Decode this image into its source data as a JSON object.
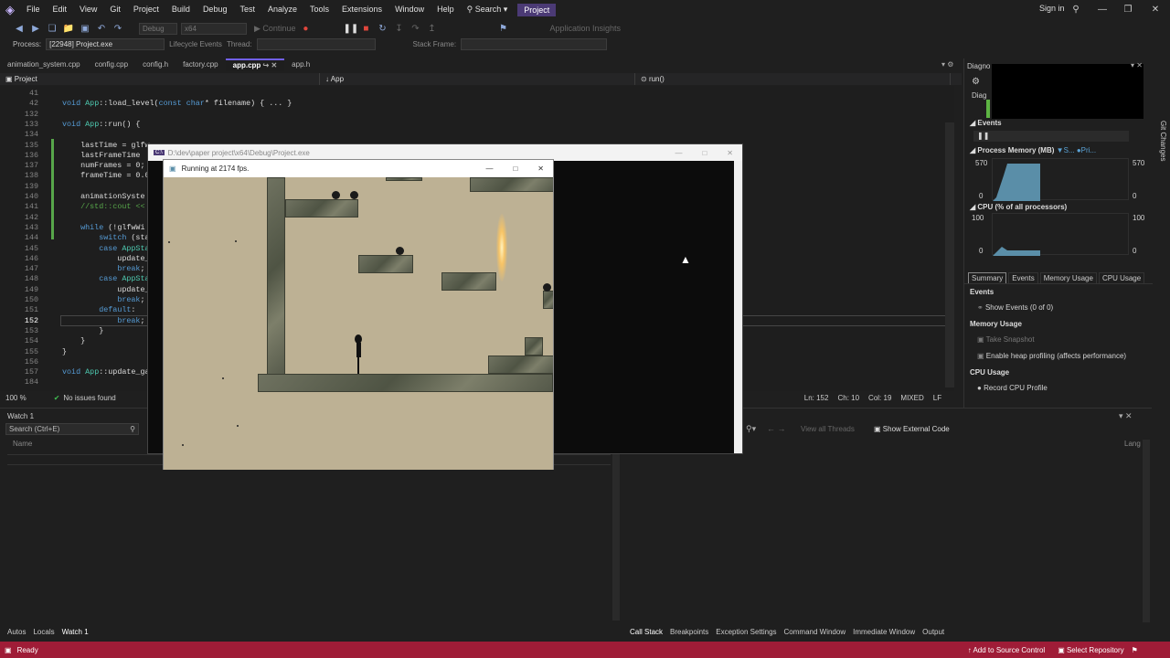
{
  "menubar": {
    "items": [
      "File",
      "Edit",
      "View",
      "Git",
      "Project",
      "Build",
      "Debug",
      "Test",
      "Analyze",
      "Tools",
      "Extensions",
      "Window",
      "Help"
    ],
    "search": "Search",
    "project_badge": "Project",
    "sign_in": "Sign in"
  },
  "toolbar": {
    "config": "Debug",
    "platform": "x64",
    "continue": "Continue",
    "insights": "Application Insights"
  },
  "toolbar2": {
    "process_label": "Process:",
    "process_value": "[22948] Project.exe",
    "lifecycle": "Lifecycle Events",
    "thread_label": "Thread:",
    "stack_label": "Stack Frame:"
  },
  "tabs": [
    {
      "label": "animation_system.cpp",
      "active": false
    },
    {
      "label": "config.cpp",
      "active": false
    },
    {
      "label": "config.h",
      "active": false
    },
    {
      "label": "factory.cpp",
      "active": false
    },
    {
      "label": "app.cpp",
      "active": true
    },
    {
      "label": "app.h",
      "active": false
    }
  ],
  "navbar": {
    "project": "Project",
    "scope": "App",
    "member": "run()"
  },
  "code_lines": [
    {
      "n": "41",
      "t": ""
    },
    {
      "n": "42",
      "t": "void App::load_level(const char* filename) { ... }"
    },
    {
      "n": "132",
      "t": ""
    },
    {
      "n": "133",
      "t": "void App::run() {"
    },
    {
      "n": "134",
      "t": ""
    },
    {
      "n": "135",
      "t": "    lastTime = glfw"
    },
    {
      "n": "136",
      "t": "    lastFrameTime"
    },
    {
      "n": "137",
      "t": "    numFrames = 0;"
    },
    {
      "n": "138",
      "t": "    frameTime = 0.0"
    },
    {
      "n": "139",
      "t": ""
    },
    {
      "n": "140",
      "t": "    animationSyste"
    },
    {
      "n": "141",
      "t": "    //std::cout <<"
    },
    {
      "n": "142",
      "t": ""
    },
    {
      "n": "143",
      "t": "    while (!glfwWi"
    },
    {
      "n": "144",
      "t": "        switch (sta"
    },
    {
      "n": "145",
      "t": "        case AppSta"
    },
    {
      "n": "146",
      "t": "            update_"
    },
    {
      "n": "147",
      "t": "            break;"
    },
    {
      "n": "148",
      "t": "        case AppSta"
    },
    {
      "n": "149",
      "t": "            update_"
    },
    {
      "n": "150",
      "t": "            break;"
    },
    {
      "n": "151",
      "t": "        default:"
    },
    {
      "n": "152",
      "t": "            break;"
    },
    {
      "n": "153",
      "t": "        }"
    },
    {
      "n": "154",
      "t": "    }"
    },
    {
      "n": "155",
      "t": "}"
    },
    {
      "n": "156",
      "t": ""
    },
    {
      "n": "157",
      "t": "void App::update_ga"
    },
    {
      "n": "184",
      "t": ""
    }
  ],
  "editor_status": {
    "zoom": "100 %",
    "issues": "No issues found",
    "ln": "Ln: 152",
    "ch": "Ch: 10",
    "col": "Col: 19",
    "mode": "MIXED",
    "eol": "LF"
  },
  "watch": {
    "title": "Watch 1",
    "search_placeholder": "Search (Ctrl+E)",
    "col_name": "Name"
  },
  "callstack_toolbar": {
    "view_threads": "View all Threads",
    "show_external": "Show External Code",
    "lang": "Lang"
  },
  "bottom_left_tabs": [
    "Autos",
    "Locals",
    "Watch 1"
  ],
  "bottom_right_tabs": [
    "Call Stack",
    "Breakpoints",
    "Exception Settings",
    "Command Window",
    "Immediate Window",
    "Output"
  ],
  "statusbar": {
    "ready": "Ready",
    "source_control": "Add to Source Control",
    "repository": "Select Repository"
  },
  "diagnostics": {
    "title": "Diagno",
    "title2": "Diag",
    "events": "Events",
    "process_memory": "Process Memory (MB)",
    "legend_s": "S...",
    "legend_p": "Pri...",
    "mem_max": "570",
    "mem_min": "0",
    "cpu_title": "CPU (% of all processors)",
    "cpu_max": "100",
    "cpu_min": "0",
    "tabs": [
      "Summary",
      "Events",
      "Memory Usage",
      "CPU Usage"
    ],
    "events_header": "Events",
    "show_events": "Show Events (0 of 0)",
    "memory_header": "Memory Usage",
    "take_snapshot": "Take Snapshot",
    "heap_profiling": "Enable heap profiling (affects performance)",
    "cpu_header": "CPU Usage",
    "record_cpu": "Record CPU Profile",
    "git_changes": "Git Changes"
  },
  "console_window": {
    "title": "D:\\dev\\paper project\\x64\\Debug\\Project.exe"
  },
  "game_window": {
    "title": "Running at 2174 fps."
  }
}
